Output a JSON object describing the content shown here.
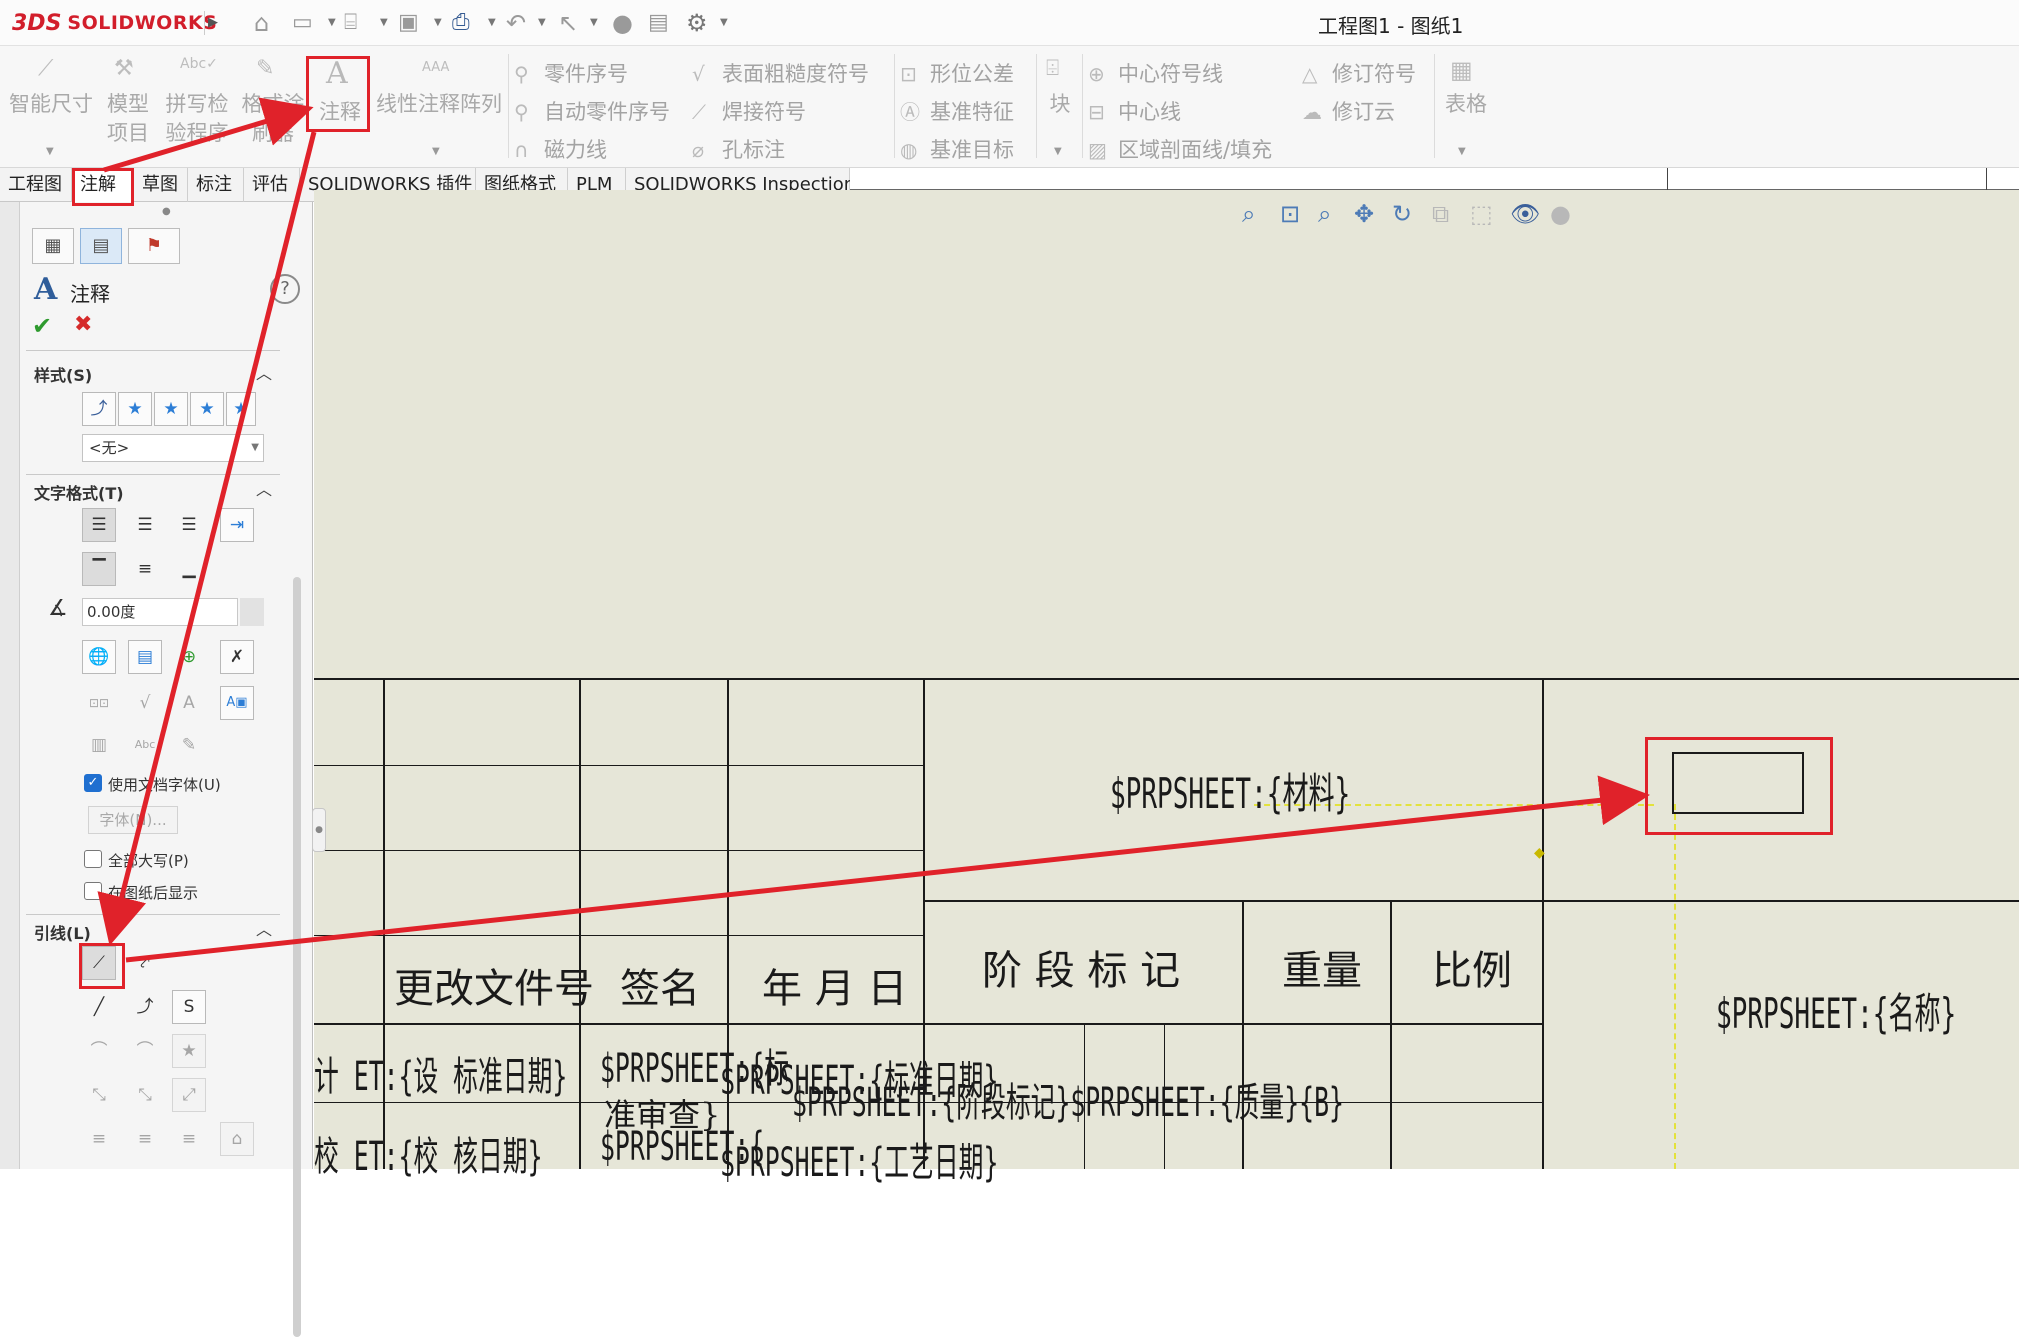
{
  "app": {
    "logo_prefix": "3DS",
    "logo_text": "SOLIDWORKS",
    "title": "工程图1 - 图纸1"
  },
  "quick_access": [
    "home-icon",
    "new-file-icon",
    "open-file-icon",
    "save-icon",
    "print-icon",
    "undo-icon",
    "select-icon",
    "rebuild-icon",
    "file-properties-icon",
    "options-gear-icon"
  ],
  "ribbon": {
    "smart_dimension": "智能尺寸",
    "model_items_1": "模型",
    "model_items_2": "项目",
    "spell_check_1": "拼写检",
    "spell_check_2": "验程序",
    "format_painter_1": "格式涂",
    "format_painter_2": "刷器",
    "note": "注释",
    "linear_note_pattern": "线性注释阵列",
    "balloon": "零件序号",
    "auto_balloon": "自动零件序号",
    "magnetic_line": "磁力线",
    "surface_finish": "表面粗糙度符号",
    "weld_symbol": "焊接符号",
    "hole_callout": "孔标注",
    "geometric_tolerance": "形位公差",
    "datum_feature": "基准特征",
    "datum_target": "基准目标",
    "block": "块",
    "center_mark": "中心符号线",
    "centerline": "中心线",
    "area_hatch": "区域剖面线/填充",
    "revision_symbol": "修订符号",
    "revision_cloud": "修订云",
    "table": "表格"
  },
  "tabs": [
    {
      "label": "工程图"
    },
    {
      "label": "注解"
    },
    {
      "label": "草图"
    },
    {
      "label": "标注"
    },
    {
      "label": "评估"
    },
    {
      "label": "SOLIDWORKS 插件"
    },
    {
      "label": "图纸格式"
    },
    {
      "label": "PLM"
    },
    {
      "label": "SOLIDWORKS Inspection"
    }
  ],
  "panel": {
    "title": "注释",
    "help": "?",
    "ok": "✔",
    "cancel": "✖",
    "style_section": "样式(S)",
    "style_value": "<无>",
    "text_format_section": "文字格式(T)",
    "angle_value": "0.00度",
    "use_doc_font": "使用文档字体(U)",
    "font_button": "字体(N)...",
    "all_caps": "全部大写(P)",
    "display_behind_sheet": "在图纸后显示",
    "leader_section": "引线(L)",
    "checks": {
      "use_doc_font": true,
      "all_caps": false,
      "display_behind_sheet": false
    }
  },
  "title_block": {
    "material": "$PRPSHEET:{材料}",
    "name": "$PRPSHEET:{名称}",
    "change_doc_no": "更改文件号",
    "signature": "签名",
    "date_ymd": "年 月 日",
    "stage_mark": "阶 段 标 记",
    "weight": "重量",
    "scale": "比例",
    "row1_col1": "计 ET:{设 标准日期}",
    "row1_col2": "$PRPSHEET:{标",
    "row1_col2b": "准审查}",
    "row1_col3": "$PRPSHEET:{标准日期}",
    "row1_col4": "$PRPSHEET:{阶段标记}$PRPSHEET:{质量}{B}",
    "row2_col1": "校 ET:{校 核日期}",
    "row2_col2": "$PRPSHEET:{",
    "row2_col3": "$PRPSHEET:{工艺日期}"
  },
  "colors": {
    "highlight_red": "#e0222a",
    "canvas_bg": "#e6e6d8",
    "yellow_guide": "#e3e23c",
    "brand_red": "#d21e2b"
  }
}
